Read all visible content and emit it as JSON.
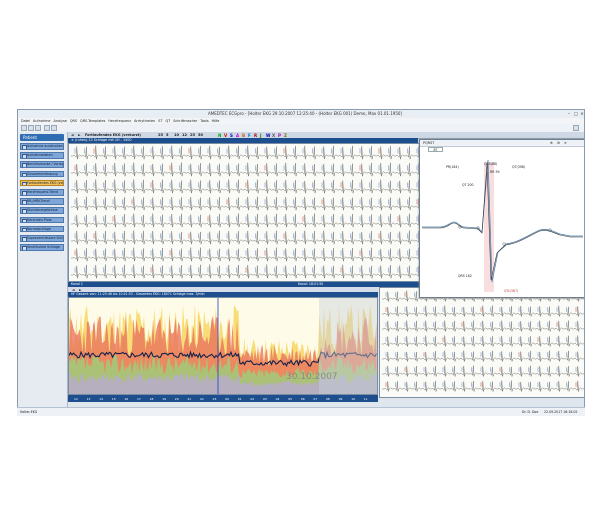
{
  "window": {
    "title": "AMEDTEC ECGpro  -  [Holter EKG 29.10.2007 12:25:40 - (Holter EKG 001) Demo, Max 01.01.1950]"
  },
  "menu": [
    "Datei",
    "Aufnahme",
    "Analyse",
    "QRS",
    "QRS-Templates",
    "Herzfrequenz",
    "Arrhythmien",
    "ST",
    "QT",
    "Schrittmacher",
    "Tools",
    "Hilfe"
  ],
  "toolbar": {
    "labels": [
      "N",
      "V",
      "S",
      "A",
      "B",
      "F",
      "R",
      "J",
      "W",
      "X",
      "P",
      "Z"
    ],
    "speed_values": [
      "25",
      "5",
      "10",
      "12",
      "25",
      "50"
    ]
  },
  "sidebar": {
    "patient_label": "Patient",
    "items": [
      {
        "label": "Aufnahme ausdrucken"
      },
      {
        "label": "Aufnahmedaten"
      },
      {
        "label": "Berichtsmaske / Vorlagen"
      },
      {
        "label": "Zusammenfassung"
      },
      {
        "label": "Fortlaufendes EKG (verkurzt)"
      },
      {
        "label": "Herzfrequenz-Trend"
      },
      {
        "label": "RR-/HRV-Trend"
      },
      {
        "label": "Stundenergebnisse"
      },
      {
        "label": "Herzraten-Plots"
      },
      {
        "label": "Normalschlage"
      },
      {
        "label": "Supraventrikulare Schlage"
      },
      {
        "label": "Ventrikulare Schlage"
      }
    ]
  },
  "main": {
    "tab_title": "Fortlaufendes EKG (verkurzt)",
    "ecg_subhead": "± (ruhes)-13 Schlage mit 1H  - 1500",
    "ecg_footer_left": "Kanal 1",
    "ecg_footer_right": "Kanal:  18:01:50",
    "trend_subhead": "HF  Gesamt von: 11:25:46 bis 10:41:53 - Gesamtes EKG:  18071 Schlage  max. 3/min",
    "date_overlay": "30.10.2007",
    "timeline_hours": [
      "12",
      "13",
      "14",
      "15",
      "16",
      "17",
      "18",
      "19",
      "20",
      "21",
      "22",
      "23",
      "00",
      "01",
      "02",
      "03",
      "04",
      "05",
      "06",
      "07",
      "08",
      "09",
      "10",
      "11"
    ],
    "status_left": "Normal",
    "right_footer": "10:29:21"
  },
  "qrs_popup": {
    "tab": "PQRST",
    "value": "87",
    "labels": {
      "pr": "PR(164)",
      "qrs": "QRS(88)",
      "qt": "QT(398)",
      "rr": "RR 59",
      "qt_corr": "QT 200",
      "qrs_onset": "QRS 162",
      "qtc": "QTc(387)",
      "p_wave": "P"
    }
  },
  "statusbar": {
    "left": "Holter-EKG",
    "right1": "Dr. D. Doe",
    "right2": "22.09.2017 16:18:02"
  }
}
